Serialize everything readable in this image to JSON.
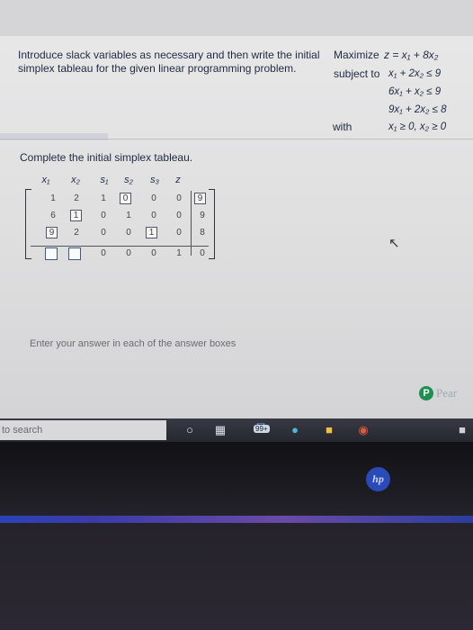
{
  "problem": {
    "prompt": "Introduce slack variables as necessary and then write the initial simplex tableau for the given linear programming problem.",
    "maximize_label": "Maximize",
    "objective": "z = x₁ + 8x₂",
    "subject_label": "subject to",
    "constraints": [
      "x₁ + 2x₂ ≤ 9",
      "6x₁ + x₂ ≤ 9",
      "9x₁ + 2x₂ ≤ 8"
    ],
    "with_label": "with",
    "nonnegativity": "x₁ ≥ 0, x₂ ≥ 0"
  },
  "tableau": {
    "instruction": "Complete the initial simplex tableau.",
    "headers": [
      "x₁",
      "x₂",
      "s₁",
      "s₂",
      "s₃",
      "z"
    ],
    "row1": [
      "1",
      "2",
      "1",
      "0",
      "0",
      "0",
      "9"
    ],
    "row2": [
      "6",
      "1",
      "0",
      "1",
      "0",
      "0",
      "9"
    ],
    "row3": [
      "9",
      "2",
      "0",
      "0",
      "1",
      "0",
      "8"
    ],
    "row4": [
      "",
      "",
      "0",
      "0",
      "0",
      "1",
      "0"
    ]
  },
  "footer": {
    "hint": "Enter your answer in each of the answer boxes",
    "brand_text": "Pear"
  },
  "taskbar": {
    "search_placeholder": "to search",
    "badge": "99+"
  },
  "laptop": {
    "logo": "hp"
  }
}
